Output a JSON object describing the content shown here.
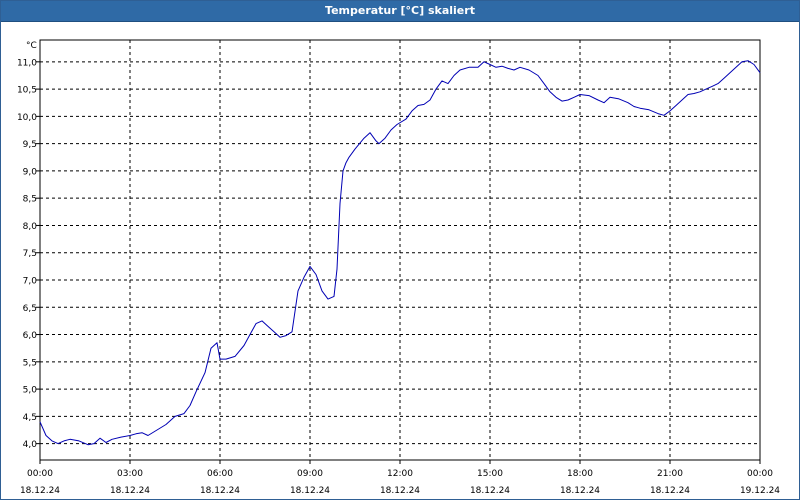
{
  "window": {
    "title": "Temperatur [°C] skaliert"
  },
  "chart_data": {
    "type": "line",
    "title": "Temperatur [°C] skaliert",
    "ylabel": "°C",
    "xlabel": "",
    "ylim": [
      3.7,
      11.4
    ],
    "grid": true,
    "y_ticks": [
      "4,0",
      "4,5",
      "5,0",
      "5,5",
      "6,0",
      "6,5",
      "7,0",
      "7,5",
      "8,0",
      "8,5",
      "9,0",
      "9,5",
      "10,0",
      "10,5",
      "11,0"
    ],
    "y_tick_values": [
      4.0,
      4.5,
      5.0,
      5.5,
      6.0,
      6.5,
      7.0,
      7.5,
      8.0,
      8.5,
      9.0,
      9.5,
      10.0,
      10.5,
      11.0
    ],
    "x_ticks": [
      {
        "time": "00:00",
        "date": "18.12.24"
      },
      {
        "time": "03:00",
        "date": "18.12.24"
      },
      {
        "time": "06:00",
        "date": "18.12.24"
      },
      {
        "time": "09:00",
        "date": "18.12.24"
      },
      {
        "time": "12:00",
        "date": "18.12.24"
      },
      {
        "time": "15:00",
        "date": "18.12.24"
      },
      {
        "time": "18:00",
        "date": "18.12.24"
      },
      {
        "time": "21:00",
        "date": "18.12.24"
      },
      {
        "time": "00:00",
        "date": "19.12.24"
      }
    ],
    "x_tick_hours": [
      0,
      3,
      6,
      9,
      12,
      15,
      18,
      21,
      24
    ],
    "line_color": "#0000b4",
    "series": [
      {
        "x_hours": [
          0.0,
          0.2,
          0.4,
          0.6,
          0.8,
          1.0,
          1.3,
          1.6,
          1.8,
          2.0,
          2.2,
          2.4,
          2.7,
          3.0,
          3.2,
          3.4,
          3.6,
          3.9,
          4.2,
          4.5,
          4.8,
          5.0,
          5.2,
          5.5,
          5.7,
          5.9,
          6.0,
          6.2,
          6.5,
          6.8,
          7.0,
          7.2,
          7.4,
          7.6,
          7.8,
          8.0,
          8.2,
          8.4,
          8.6,
          8.8,
          9.0,
          9.2,
          9.4,
          9.6,
          9.8,
          9.9,
          10.0,
          10.1,
          10.2,
          10.3,
          10.5,
          10.8,
          11.0,
          11.2,
          11.3,
          11.5,
          11.7,
          11.9,
          12.2,
          12.4,
          12.6,
          12.8,
          13.0,
          13.2,
          13.4,
          13.6,
          13.8,
          14.0,
          14.3,
          14.6,
          14.8,
          15.0,
          15.2,
          15.4,
          15.6,
          15.8,
          16.0,
          16.3,
          16.6,
          16.8,
          17.0,
          17.2,
          17.4,
          17.6,
          17.8,
          18.0,
          18.3,
          18.6,
          18.8,
          19.0,
          19.3,
          19.6,
          19.8,
          20.0,
          20.3,
          20.6,
          20.8,
          21.0,
          21.2,
          21.4,
          21.6,
          21.8,
          22.0,
          22.2,
          22.4,
          22.6,
          22.8,
          23.0,
          23.2,
          23.4,
          23.6,
          23.8,
          24.0
        ],
        "values": [
          4.4,
          4.15,
          4.05,
          4.0,
          4.05,
          4.08,
          4.05,
          3.98,
          4.0,
          4.1,
          4.02,
          4.08,
          4.12,
          4.15,
          4.18,
          4.2,
          4.15,
          4.25,
          4.35,
          4.5,
          4.55,
          4.7,
          4.95,
          5.3,
          5.75,
          5.85,
          5.55,
          5.55,
          5.6,
          5.8,
          6.0,
          6.2,
          6.25,
          6.15,
          6.05,
          5.95,
          5.98,
          6.05,
          6.8,
          7.05,
          7.25,
          7.1,
          6.8,
          6.65,
          6.7,
          7.2,
          8.4,
          9.0,
          9.15,
          9.25,
          9.4,
          9.6,
          9.7,
          9.55,
          9.5,
          9.6,
          9.75,
          9.85,
          9.95,
          10.1,
          10.2,
          10.22,
          10.3,
          10.5,
          10.65,
          10.6,
          10.75,
          10.85,
          10.9,
          10.9,
          11.0,
          10.95,
          10.9,
          10.92,
          10.88,
          10.85,
          10.9,
          10.85,
          10.75,
          10.6,
          10.45,
          10.35,
          10.28,
          10.3,
          10.35,
          10.4,
          10.38,
          10.3,
          10.25,
          10.35,
          10.32,
          10.25,
          10.18,
          10.15,
          10.12,
          10.05,
          10.02,
          10.1,
          10.2,
          10.3,
          10.4,
          10.42,
          10.45,
          10.5,
          10.55,
          10.6,
          10.7,
          10.8,
          10.9,
          11.0,
          11.02,
          10.95,
          10.8
        ]
      }
    ]
  }
}
